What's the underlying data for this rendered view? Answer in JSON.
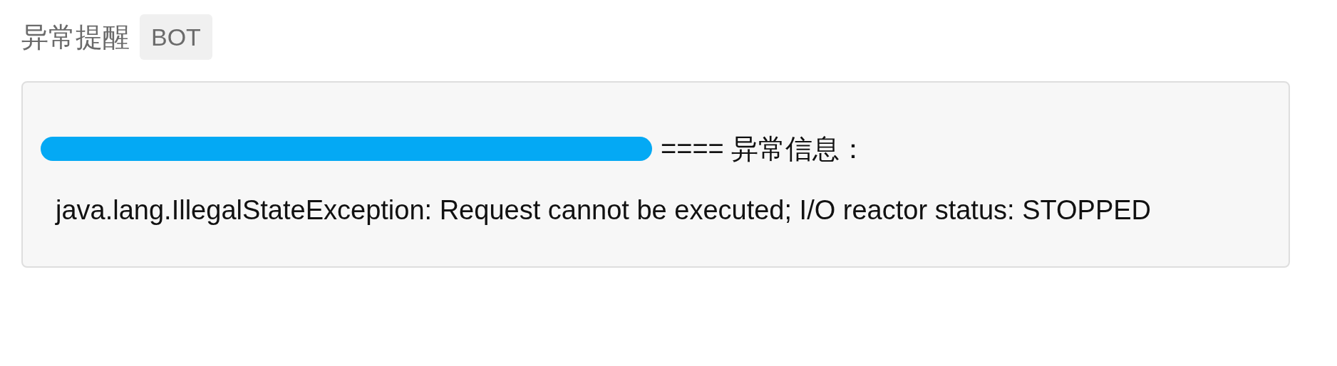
{
  "header": {
    "title": "异常提醒",
    "badge": "BOT"
  },
  "message": {
    "redacted": true,
    "heading": "==== 异常信息：",
    "body": "java.lang.IllegalStateException: Request cannot be executed; I/O reactor status: STOPPED"
  }
}
